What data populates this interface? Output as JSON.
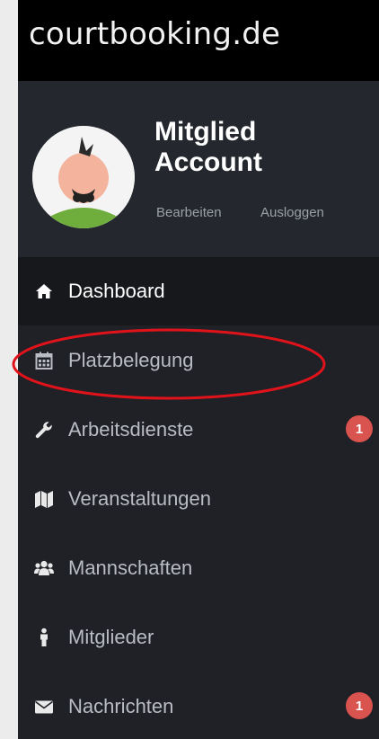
{
  "brand": {
    "name": "courtbooking.de"
  },
  "profile": {
    "name": "Mitglied Account",
    "edit_label": "Bearbeiten",
    "logout_label": "Ausloggen"
  },
  "nav": {
    "items": [
      {
        "label": "Dashboard",
        "icon": "home-icon",
        "active": true
      },
      {
        "label": "Platzbelegung",
        "icon": "calendar-icon",
        "active": false
      },
      {
        "label": "Arbeitsdienste",
        "icon": "wrench-icon",
        "active": false,
        "badge": "1"
      },
      {
        "label": "Veranstaltungen",
        "icon": "map-icon",
        "active": false
      },
      {
        "label": "Mannschaften",
        "icon": "users-icon",
        "active": false
      },
      {
        "label": "Mitglieder",
        "icon": "person-icon",
        "active": false
      },
      {
        "label": "Nachrichten",
        "icon": "envelope-icon",
        "active": false,
        "badge": "1"
      }
    ]
  },
  "colors": {
    "sidebar_bg": "#1f2127",
    "brand_bg": "#000000",
    "active_bg": "#17181c",
    "badge": "#d9534f",
    "annotation_ring": "#e0121a"
  }
}
